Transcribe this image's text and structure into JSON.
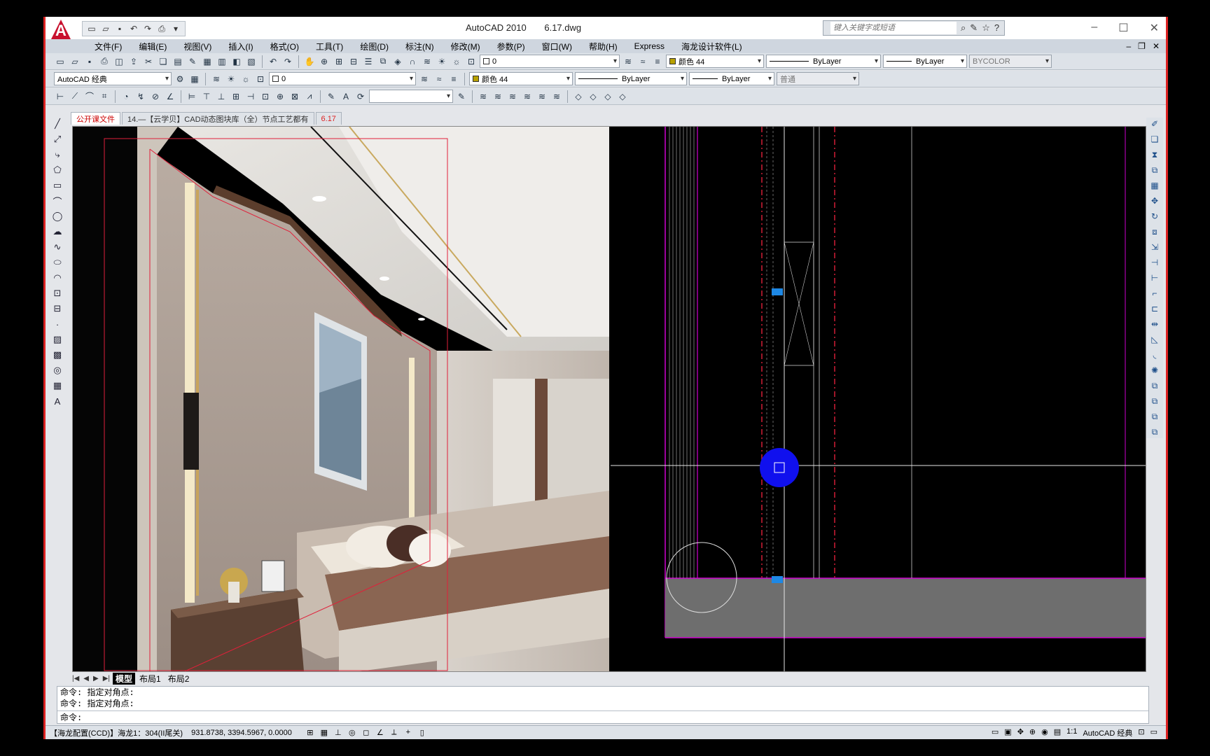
{
  "app": {
    "name": "AutoCAD 2010",
    "file": "6.17.dwg",
    "search_placeholder": "键入关键字或短语"
  },
  "menu": [
    "文件(F)",
    "编辑(E)",
    "视图(V)",
    "插入(I)",
    "格式(O)",
    "工具(T)",
    "绘图(D)",
    "标注(N)",
    "修改(M)",
    "参数(P)",
    "窗口(W)",
    "帮助(H)",
    "Express",
    "海龙设计软件(L)"
  ],
  "toolbar1": {
    "layer_value": "0",
    "color_value": "颜色 44",
    "linetype_value": "ByLayer",
    "lineweight_value": "ByLayer",
    "plotstyle_value": "BYCOLOR"
  },
  "toolbar2": {
    "workspace": "AutoCAD 经典",
    "layer_value": "0",
    "color_value": "颜色 44",
    "linetype_value": "ByLayer",
    "lineweight_value": "ByLayer",
    "plotstyle_value": "普通"
  },
  "file_tabs": [
    "公开课文件",
    "14.—【云学贝】CAD动态图块库（全）节点工艺都有",
    "6.17"
  ],
  "layout_tabs": [
    "模型",
    "布局1",
    "布局2"
  ],
  "command": {
    "history": [
      "命令: 指定对角点:",
      "命令: 指定对角点:"
    ],
    "prompt_label": "命令:",
    "input_value": ""
  },
  "status": {
    "left_text": "【海龙配置(CCD)】海龙1：304(II尾关)",
    "coords": "931.8738, 3394.5967, 0.0000",
    "scale": "1:1",
    "workspace": "AutoCAD 经典"
  },
  "colors": {
    "magenta": "#d000d0",
    "red_line": "#e0203a",
    "grip_blue": "#1e88e5",
    "cursor_blue": "#1010ee",
    "gray_fill": "#6e6e6e"
  }
}
